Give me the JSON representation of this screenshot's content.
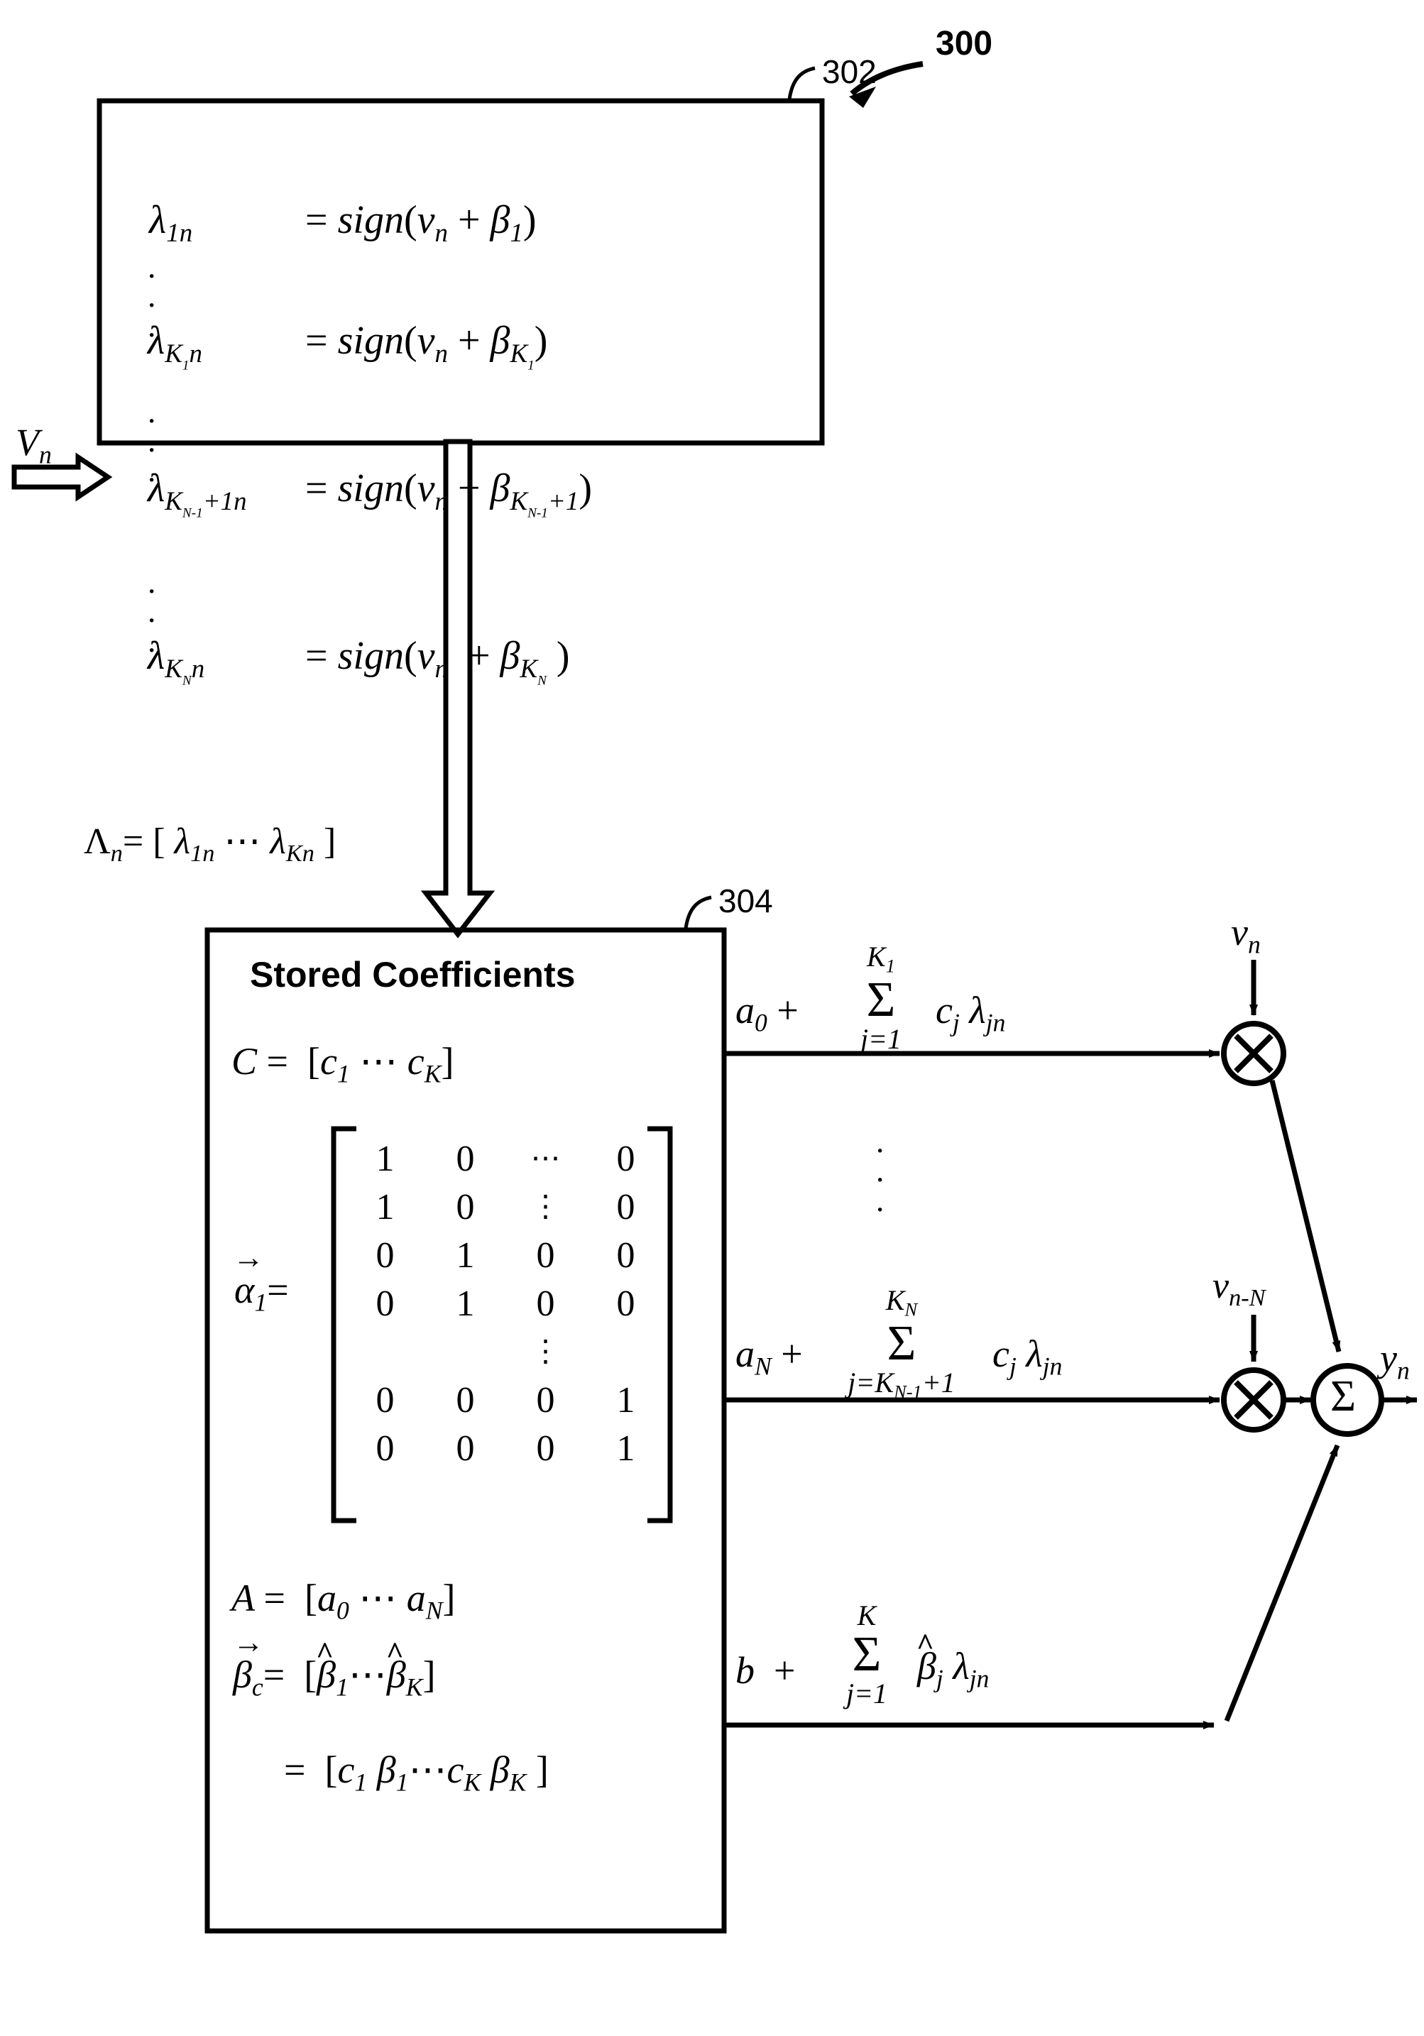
{
  "figure": {
    "number": "300",
    "blocks": [
      {
        "ref": "302",
        "title": ""
      },
      {
        "ref": "304",
        "title": "Stored Coefficients"
      }
    ]
  },
  "input": {
    "signal_label": "V",
    "signal_sub": "n"
  },
  "block302": {
    "ref": "302",
    "equations": [
      {
        "lhs_symbol": "λ",
        "lhs_sub": "1n",
        "eq": "=",
        "rhs_fn": "sign",
        "rhs_open": "(",
        "rhs_var": "v",
        "rhs_var_sub": "n",
        "rhs_plus": "+",
        "rhs_beta": "β",
        "rhs_beta_sub": "1",
        "rhs_close": ")"
      },
      {
        "lhs_symbol": "λ",
        "lhs_sub": "K",
        "lhs_sub_sub": "1",
        "lhs_sub_tail": "n",
        "eq": "=",
        "rhs_fn": "sign",
        "rhs_open": "(",
        "rhs_var": "v",
        "rhs_var_sub": "n",
        "rhs_plus": "+",
        "rhs_beta": "β",
        "rhs_beta_sub": "K",
        "rhs_beta_sub_sub": "1",
        "rhs_close": ")"
      },
      {
        "lhs_symbol": "λ",
        "lhs_sub": "K",
        "lhs_sub_sub": "N-1",
        "lhs_sub_tail": "+1n",
        "eq": "=",
        "rhs_fn": "sign",
        "rhs_open": "(",
        "rhs_var": "v",
        "rhs_var_sub": "n",
        "rhs_plus": "+",
        "rhs_beta": "β",
        "rhs_beta_sub": "K",
        "rhs_beta_sub_sub": "N-1",
        "rhs_beta_sub_tail": "+1",
        "rhs_close": ")"
      },
      {
        "lhs_symbol": "λ",
        "lhs_sub": "K",
        "lhs_sub_sub": "N",
        "lhs_sub_tail": "n",
        "eq": "=",
        "rhs_fn": "sign",
        "rhs_open": "(",
        "rhs_var": "v",
        "rhs_var_sub": "n",
        "rhs_plus": "+",
        "rhs_beta": "β",
        "rhs_beta_sub": "K",
        "rhs_beta_sub_sub": "N",
        "rhs_close": ")"
      }
    ],
    "ellipsis": "⋮"
  },
  "lambda_vector": {
    "name": "Λ",
    "name_sub": "n",
    "eq": "=",
    "open": "[",
    "first": "λ",
    "first_sub": "1n",
    "dots": "⋯",
    "last": "λ",
    "last_sub": "Kn",
    "close": "]"
  },
  "block304": {
    "ref": "304",
    "title": "Stored Coefficients",
    "c_vector": {
      "name": "C",
      "eq": "=",
      "open": "[",
      "first": "c",
      "first_sub": "1",
      "dots": "⋯",
      "last": "c",
      "last_sub": "K",
      "close": "]"
    },
    "alpha_matrix": {
      "name": "α",
      "name_sub": "1",
      "eq": "=",
      "rows": [
        [
          "1",
          "0",
          "⋯",
          "0"
        ],
        [
          "1",
          "0",
          "⋮",
          "0"
        ],
        [
          "0",
          "1",
          "0",
          "0"
        ],
        [
          "0",
          "1",
          "0",
          "0"
        ],
        [
          "",
          "",
          "⋮",
          ""
        ],
        [
          "0",
          "0",
          "0",
          "1"
        ],
        [
          "0",
          "0",
          "0",
          "1"
        ]
      ]
    },
    "a_vector": {
      "name": "A",
      "eq": "=",
      "open": "[",
      "first": "a",
      "first_sub": "0",
      "dots": "⋯",
      "last": "a",
      "last_sub": "N",
      "close": "]"
    },
    "beta_c_vector": {
      "name": "β",
      "name_sub": "c",
      "eq": "=",
      "open": "[",
      "hat": "^",
      "first": "β",
      "first_sub": "1",
      "dots": "⋯",
      "last": "β",
      "last_sub": "K",
      "close": "]"
    },
    "beta_c_expanded": {
      "eq": "=",
      "open": "[",
      "c1": "c",
      "c1_sub": "1",
      "b1": "β",
      "b1_sub": "1",
      "dots": "⋯",
      "cK": "c",
      "cK_sub": "K",
      "bK": "β",
      "bK_sub": "K",
      "close": "]"
    }
  },
  "sums": [
    {
      "id": "sum-top",
      "lead": "a",
      "lead_sub": "0",
      "plus": "+",
      "sigma": "Σ",
      "upper": "K",
      "upper_sub": "1",
      "lower": "j=1",
      "term1": "c",
      "term1_sub": "j",
      "term2": "λ",
      "term2_sub": "jn"
    },
    {
      "id": "sum-mid",
      "lead": "a",
      "lead_sub": "N",
      "plus": "+",
      "sigma": "Σ",
      "upper": "K",
      "upper_sub": "N",
      "lower": "j=K",
      "lower_sub": "N-1",
      "lower_tail": "+1",
      "term1": "c",
      "term1_sub": "j",
      "term2": "λ",
      "term2_sub": "jn"
    },
    {
      "id": "sum-bottom",
      "lead": "b",
      "plus": "+",
      "sigma": "Σ",
      "upper": "K",
      "lower": "j=1",
      "hat": "^",
      "term1": "β",
      "term1_sub": "j",
      "term2": "λ",
      "term2_sub": "jn"
    }
  ],
  "nodes": {
    "multiplier_top": {
      "glyph": "×",
      "input_label": "v",
      "input_sub": "n"
    },
    "multiplier_bottom": {
      "glyph": "×",
      "input_label": "v",
      "input_sub": "n-N"
    },
    "summer": {
      "glyph": "Σ"
    },
    "output": {
      "label": "y",
      "sub": "n"
    }
  },
  "vertical_ellipsis": "⋮",
  "colors": {
    "ink": "#000000",
    "paper": "#ffffff"
  }
}
